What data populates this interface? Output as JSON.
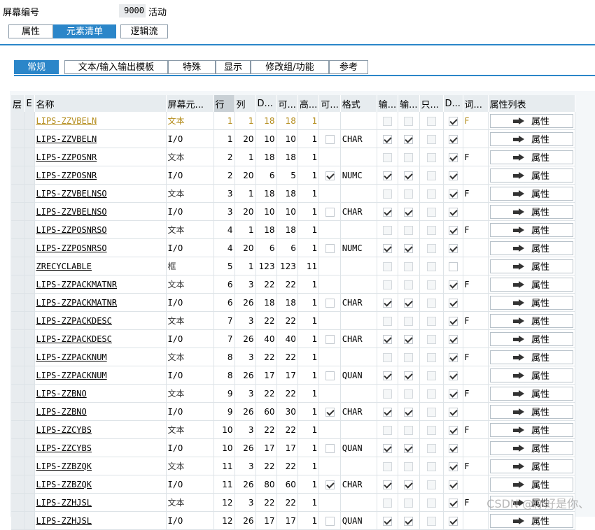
{
  "header": {
    "label": "屏幕编号",
    "number": "9000",
    "description": "活动"
  },
  "tabs": [
    {
      "label": "属性",
      "active": false
    },
    {
      "label": "元素清单",
      "active": true
    },
    {
      "label": "逻辑流",
      "active": false
    }
  ],
  "subtabs": [
    {
      "label": "常规",
      "active": true
    },
    {
      "label": "文本/输入输出模板",
      "active": false
    },
    {
      "label": "特殊",
      "active": false
    },
    {
      "label": "显示",
      "active": false
    },
    {
      "label": "修改组/功能",
      "active": false
    },
    {
      "label": "参考",
      "active": false
    }
  ],
  "columns": [
    "层",
    "E",
    "名称",
    "屏幕元...",
    "行",
    "列",
    "D...",
    "可...",
    "高...",
    "可...",
    "格式",
    "输...",
    "输...",
    "只...",
    "D...",
    "词...",
    "属性列表"
  ],
  "button_label": "属性",
  "rows": [
    {
      "name": "LIPS-ZZVBELN",
      "type": "文本",
      "row": "1",
      "col": "1",
      "d": "18",
      "v": "18",
      "h": "1",
      "ck": null,
      "fmt": "",
      "in": false,
      "out": false,
      "ro": false,
      "dd": true,
      "dict": "F"
    },
    {
      "name": "LIPS-ZZVBELN",
      "type": "I/O",
      "row": "1",
      "col": "20",
      "d": "10",
      "v": "10",
      "h": "1",
      "ck": false,
      "fmt": "CHAR",
      "in": true,
      "out": true,
      "ro": false,
      "dd": true,
      "dict": ""
    },
    {
      "name": "LIPS-ZZPOSNR",
      "type": "文本",
      "row": "2",
      "col": "1",
      "d": "18",
      "v": "18",
      "h": "1",
      "ck": null,
      "fmt": "",
      "in": false,
      "out": false,
      "ro": false,
      "dd": true,
      "dict": "F"
    },
    {
      "name": "LIPS-ZZPOSNR",
      "type": "I/O",
      "row": "2",
      "col": "20",
      "d": "6",
      "v": "5",
      "h": "1",
      "ck": true,
      "fmt": "NUMC",
      "in": true,
      "out": true,
      "ro": false,
      "dd": true,
      "dict": ""
    },
    {
      "name": "LIPS-ZZVBELNSO",
      "type": "文本",
      "row": "3",
      "col": "1",
      "d": "18",
      "v": "18",
      "h": "1",
      "ck": null,
      "fmt": "",
      "in": false,
      "out": false,
      "ro": false,
      "dd": true,
      "dict": "F"
    },
    {
      "name": "LIPS-ZZVBELNSO",
      "type": "I/O",
      "row": "3",
      "col": "20",
      "d": "10",
      "v": "10",
      "h": "1",
      "ck": false,
      "fmt": "CHAR",
      "in": true,
      "out": true,
      "ro": false,
      "dd": true,
      "dict": ""
    },
    {
      "name": "LIPS-ZZPOSNRSO",
      "type": "文本",
      "row": "4",
      "col": "1",
      "d": "18",
      "v": "18",
      "h": "1",
      "ck": null,
      "fmt": "",
      "in": false,
      "out": false,
      "ro": false,
      "dd": true,
      "dict": "F"
    },
    {
      "name": "LIPS-ZZPOSNRSO",
      "type": "I/O",
      "row": "4",
      "col": "20",
      "d": "6",
      "v": "6",
      "h": "1",
      "ck": false,
      "fmt": "NUMC",
      "in": true,
      "out": true,
      "ro": false,
      "dd": true,
      "dict": ""
    },
    {
      "name": "ZRECYCLABLE",
      "type": "框",
      "row": "5",
      "col": "1",
      "d": "123",
      "v": "123",
      "h": "11",
      "ck": null,
      "fmt": "",
      "in": false,
      "out": false,
      "ro": false,
      "dd": false,
      "dict": ""
    },
    {
      "name": "LIPS-ZZPACKMATNR",
      "type": "文本",
      "row": "6",
      "col": "3",
      "d": "22",
      "v": "22",
      "h": "1",
      "ck": null,
      "fmt": "",
      "in": false,
      "out": false,
      "ro": false,
      "dd": true,
      "dict": "F"
    },
    {
      "name": "LIPS-ZZPACKMATNR",
      "type": "I/O",
      "row": "6",
      "col": "26",
      "d": "18",
      "v": "18",
      "h": "1",
      "ck": false,
      "fmt": "CHAR",
      "in": true,
      "out": true,
      "ro": false,
      "dd": true,
      "dict": ""
    },
    {
      "name": "LIPS-ZZPACKDESC",
      "type": "文本",
      "row": "7",
      "col": "3",
      "d": "22",
      "v": "22",
      "h": "1",
      "ck": null,
      "fmt": "",
      "in": false,
      "out": false,
      "ro": false,
      "dd": true,
      "dict": "F"
    },
    {
      "name": "LIPS-ZZPACKDESC",
      "type": "I/O",
      "row": "7",
      "col": "26",
      "d": "40",
      "v": "40",
      "h": "1",
      "ck": false,
      "fmt": "CHAR",
      "in": true,
      "out": true,
      "ro": false,
      "dd": true,
      "dict": ""
    },
    {
      "name": "LIPS-ZZPACKNUM",
      "type": "文本",
      "row": "8",
      "col": "3",
      "d": "22",
      "v": "22",
      "h": "1",
      "ck": null,
      "fmt": "",
      "in": false,
      "out": false,
      "ro": false,
      "dd": true,
      "dict": "F"
    },
    {
      "name": "LIPS-ZZPACKNUM",
      "type": "I/O",
      "row": "8",
      "col": "26",
      "d": "17",
      "v": "17",
      "h": "1",
      "ck": false,
      "fmt": "QUAN",
      "in": true,
      "out": true,
      "ro": false,
      "dd": true,
      "dict": ""
    },
    {
      "name": "LIPS-ZZBNO",
      "type": "文本",
      "row": "9",
      "col": "3",
      "d": "22",
      "v": "22",
      "h": "1",
      "ck": null,
      "fmt": "",
      "in": false,
      "out": false,
      "ro": false,
      "dd": true,
      "dict": "F"
    },
    {
      "name": "LIPS-ZZBNO",
      "type": "I/O",
      "row": "9",
      "col": "26",
      "d": "60",
      "v": "30",
      "h": "1",
      "ck": true,
      "fmt": "CHAR",
      "in": true,
      "out": true,
      "ro": false,
      "dd": true,
      "dict": ""
    },
    {
      "name": "LIPS-ZZCYBS",
      "type": "文本",
      "row": "10",
      "col": "3",
      "d": "22",
      "v": "22",
      "h": "1",
      "ck": null,
      "fmt": "",
      "in": false,
      "out": false,
      "ro": false,
      "dd": true,
      "dict": "F"
    },
    {
      "name": "LIPS-ZZCYBS",
      "type": "I/O",
      "row": "10",
      "col": "26",
      "d": "17",
      "v": "17",
      "h": "1",
      "ck": false,
      "fmt": "QUAN",
      "in": true,
      "out": true,
      "ro": false,
      "dd": true,
      "dict": ""
    },
    {
      "name": "LIPS-ZZBZQK",
      "type": "文本",
      "row": "11",
      "col": "3",
      "d": "22",
      "v": "22",
      "h": "1",
      "ck": null,
      "fmt": "",
      "in": false,
      "out": false,
      "ro": false,
      "dd": true,
      "dict": "F"
    },
    {
      "name": "LIPS-ZZBZQK",
      "type": "I/O",
      "row": "11",
      "col": "26",
      "d": "80",
      "v": "60",
      "h": "1",
      "ck": true,
      "fmt": "CHAR",
      "in": true,
      "out": true,
      "ro": false,
      "dd": true,
      "dict": ""
    },
    {
      "name": "LIPS-ZZHJSL",
      "type": "文本",
      "row": "12",
      "col": "3",
      "d": "22",
      "v": "22",
      "h": "1",
      "ck": null,
      "fmt": "",
      "in": false,
      "out": false,
      "ro": false,
      "dd": true,
      "dict": "F"
    },
    {
      "name": "LIPS-ZZHJSL",
      "type": "I/O",
      "row": "12",
      "col": "26",
      "d": "17",
      "v": "17",
      "h": "1",
      "ck": false,
      "fmt": "QUAN",
      "in": true,
      "out": true,
      "ro": false,
      "dd": true,
      "dict": ""
    }
  ],
  "watermark": "CSDN @你好是你、"
}
